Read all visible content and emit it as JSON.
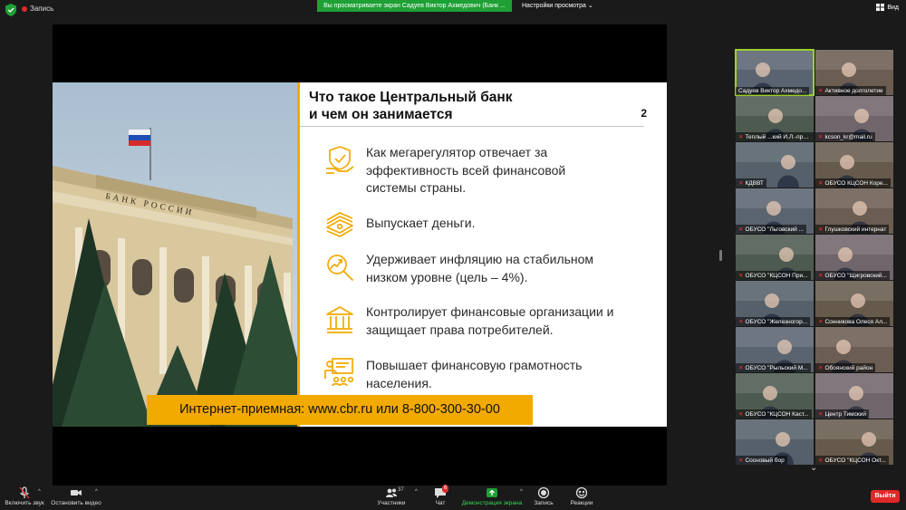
{
  "top_bar": {
    "recording_label": "Запись",
    "viewing_banner": "Вы просматриваете экран Садуев Виктор Ахмедович (Банк ...",
    "view_settings": "Настройки просмотра",
    "view_button": "Вид"
  },
  "slide": {
    "title_line1": "Что такое Центральный банк",
    "title_line2": "и чем он занимается",
    "page_number": "2",
    "items": [
      {
        "icon": "shield-hand-icon",
        "text": "Как мегарегулятор отвечает за эффективность всей финансовой системы страны."
      },
      {
        "icon": "money-stack-icon",
        "text": "Выпускает деньги."
      },
      {
        "icon": "magnifier-chart-icon",
        "text": "Удерживает инфляцию на стабильном низком уровне (цель – 4%)."
      },
      {
        "icon": "bank-building-icon",
        "text": "Контролирует финансовые организации и защищает права потребителей."
      },
      {
        "icon": "education-icon",
        "text": "Повышает финансовую грамотность населения."
      }
    ],
    "footer": "Интернет-приемная: www.cbr.ru или 8-800-300-30-00",
    "building_sign": "БАНК РОССИИ",
    "accent_color": "#f2a900"
  },
  "participants": [
    {
      "name": "Садуев Виктор Ахмедо...",
      "active": true,
      "muted": false
    },
    {
      "name": "Активное долголетие",
      "active": false,
      "muted": true
    },
    {
      "name": "Теплый ...кий И.Л.-пров...",
      "active": false,
      "muted": true
    },
    {
      "name": "kcson_kr@mail.ru",
      "active": false,
      "muted": true
    },
    {
      "name": "КДВВТ",
      "active": false,
      "muted": true
    },
    {
      "name": "ОБУСО КЦСОН Коре...",
      "active": false,
      "muted": true
    },
    {
      "name": "ОБУСО \"Льговский ...",
      "active": false,
      "muted": true
    },
    {
      "name": "Глушковский интернат",
      "active": false,
      "muted": true
    },
    {
      "name": "ОБУСО \"КЦСОН При...",
      "active": false,
      "muted": true
    },
    {
      "name": "ОБУСО \"Щигровский...",
      "active": false,
      "muted": true
    },
    {
      "name": "ОБУСО \"Железногор...",
      "active": false,
      "muted": true
    },
    {
      "name": "Сонникова Олеся Ал...",
      "active": false,
      "muted": true
    },
    {
      "name": "ОБУСО \"Рыльский М...",
      "active": false,
      "muted": true
    },
    {
      "name": "Обоянский район",
      "active": false,
      "muted": true
    },
    {
      "name": "ОБУСО \"КЦСОН Каст...",
      "active": false,
      "muted": true
    },
    {
      "name": "Центр Тимский",
      "active": false,
      "muted": true
    },
    {
      "name": "Сосновый бор",
      "active": false,
      "muted": true
    },
    {
      "name": "ОБУСО \"КЦСОН Окт...",
      "active": false,
      "muted": true
    }
  ],
  "toolbar": {
    "unmute": "Включить звук",
    "start_video": "Остановить видео",
    "participants": "Участники",
    "participants_count": "37",
    "chat": "Чат",
    "chat_badge": "6",
    "share_screen": "Демонстрация экрана",
    "record": "Запись",
    "reactions": "Реакции",
    "leave": "Выйти"
  }
}
